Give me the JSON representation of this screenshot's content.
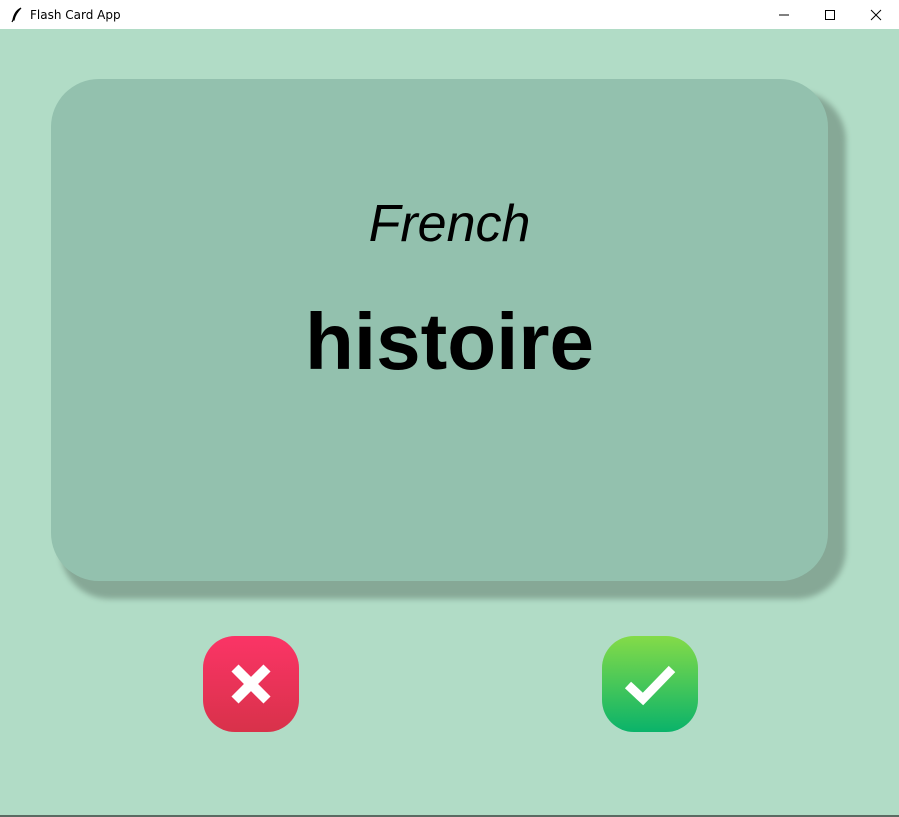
{
  "window": {
    "title": "Flash Card App",
    "icons": {
      "app": "feather-icon",
      "minimize": "minimize-icon",
      "maximize": "maximize-icon",
      "close": "close-icon"
    }
  },
  "card": {
    "title": "French",
    "word": "histoire"
  },
  "buttons": {
    "wrong": {
      "icon": "cross-icon",
      "color": "#e8344f"
    },
    "right": {
      "icon": "checkmark-icon",
      "color": "#2ec55a"
    }
  },
  "colors": {
    "background": "#b1dcc6",
    "card": "#93c1ae"
  }
}
